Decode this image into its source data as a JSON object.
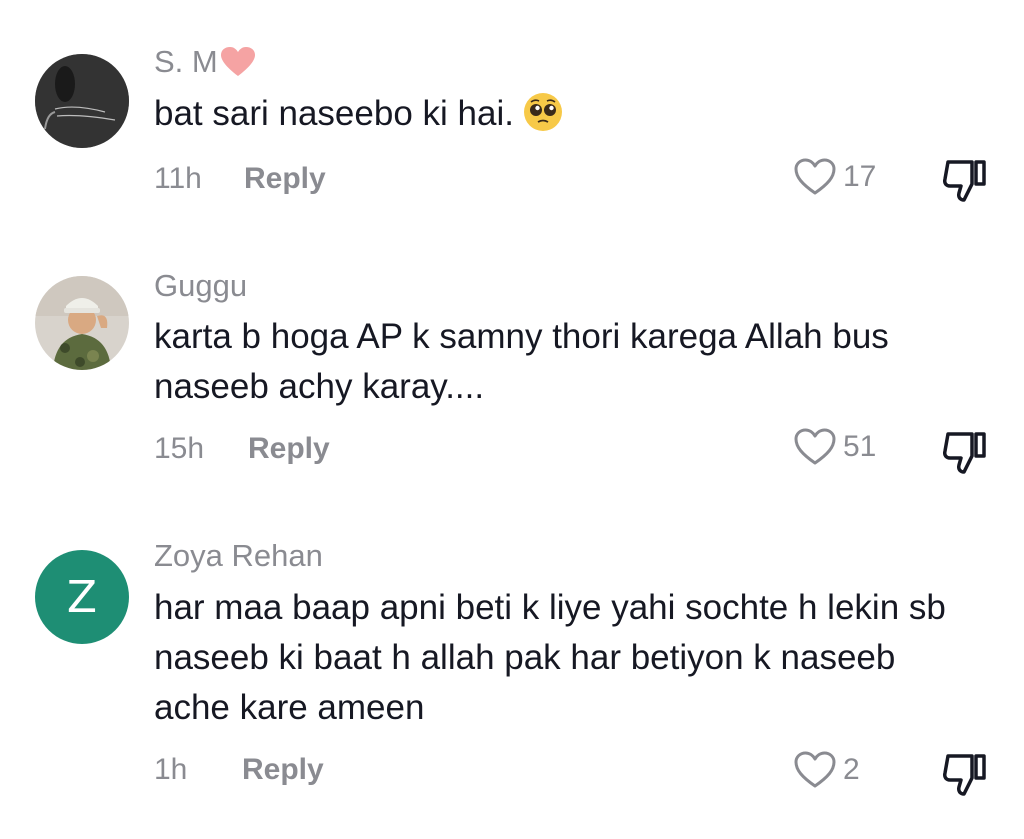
{
  "comments": [
    {
      "username": "S. M",
      "username_emoji": "heart",
      "text": "bat sari naseebo ki hai.",
      "text_emoji": "pleading-face",
      "time": "11h",
      "reply_label": "Reply",
      "likes": "17"
    },
    {
      "username": "Guggu",
      "text": "karta b hoga AP k samny thori karega Allah bus naseeb achy karay....",
      "time": "15h",
      "reply_label": "Reply",
      "likes": "51"
    },
    {
      "username": "Zoya Rehan",
      "avatar_letter": "Z",
      "text": "har maa baap apni beti k liye yahi sochte h lekin sb naseeb ki baat h allah pak har betiyon k naseeb ache kare ameen",
      "time": "1h",
      "reply_label": "Reply",
      "likes": "2"
    }
  ],
  "colors": {
    "primary_text": "#161823",
    "secondary_text": "#8a8b91",
    "avatar_z_bg": "#1e8e74"
  }
}
